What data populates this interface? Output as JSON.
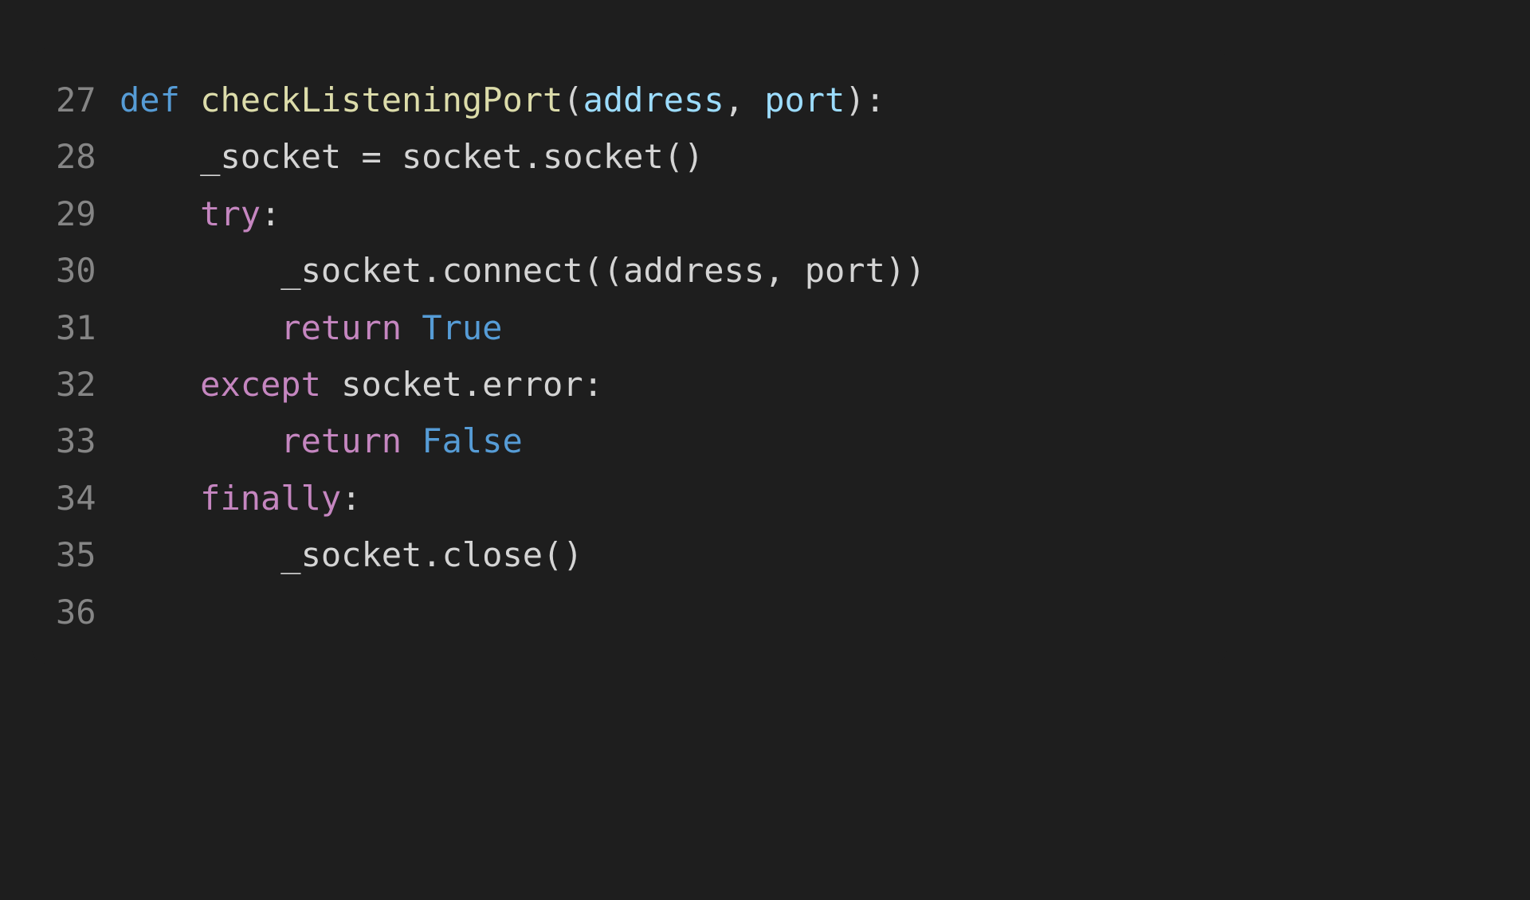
{
  "editor": {
    "language": "python",
    "startLine": 27,
    "lines": [
      {
        "num": 27,
        "indent": 0,
        "tokens": [
          {
            "t": "def ",
            "c": "tok-keyword"
          },
          {
            "t": "checkListeningPort",
            "c": "tok-funcname"
          },
          {
            "t": "(",
            "c": "tok-punct"
          },
          {
            "t": "address",
            "c": "tok-param"
          },
          {
            "t": ", ",
            "c": "tok-punct"
          },
          {
            "t": "port",
            "c": "tok-param"
          },
          {
            "t": "):",
            "c": "tok-punct"
          }
        ]
      },
      {
        "num": 28,
        "indent": 1,
        "tokens": [
          {
            "t": "_socket = socket.socket()",
            "c": "tok-var"
          }
        ]
      },
      {
        "num": 29,
        "indent": 1,
        "tokens": [
          {
            "t": "try",
            "c": "tok-control"
          },
          {
            "t": ":",
            "c": "tok-punct"
          }
        ]
      },
      {
        "num": 30,
        "indent": 2,
        "tokens": [
          {
            "t": "_socket.connect((address, port))",
            "c": "tok-var"
          }
        ]
      },
      {
        "num": 31,
        "indent": 2,
        "tokens": [
          {
            "t": "return ",
            "c": "tok-control"
          },
          {
            "t": "True",
            "c": "tok-const"
          }
        ]
      },
      {
        "num": 32,
        "indent": 1,
        "tokens": [
          {
            "t": "except ",
            "c": "tok-control"
          },
          {
            "t": "socket.error:",
            "c": "tok-var"
          }
        ]
      },
      {
        "num": 33,
        "indent": 2,
        "tokens": [
          {
            "t": "return ",
            "c": "tok-control"
          },
          {
            "t": "False",
            "c": "tok-const"
          }
        ]
      },
      {
        "num": 34,
        "indent": 1,
        "tokens": [
          {
            "t": "finally",
            "c": "tok-control"
          },
          {
            "t": ":",
            "c": "tok-punct"
          }
        ]
      },
      {
        "num": 35,
        "indent": 2,
        "tokens": [
          {
            "t": "_socket.close()",
            "c": "tok-var"
          }
        ]
      },
      {
        "num": 36,
        "indent": 0,
        "tokens": []
      }
    ],
    "indentUnit": "    "
  }
}
